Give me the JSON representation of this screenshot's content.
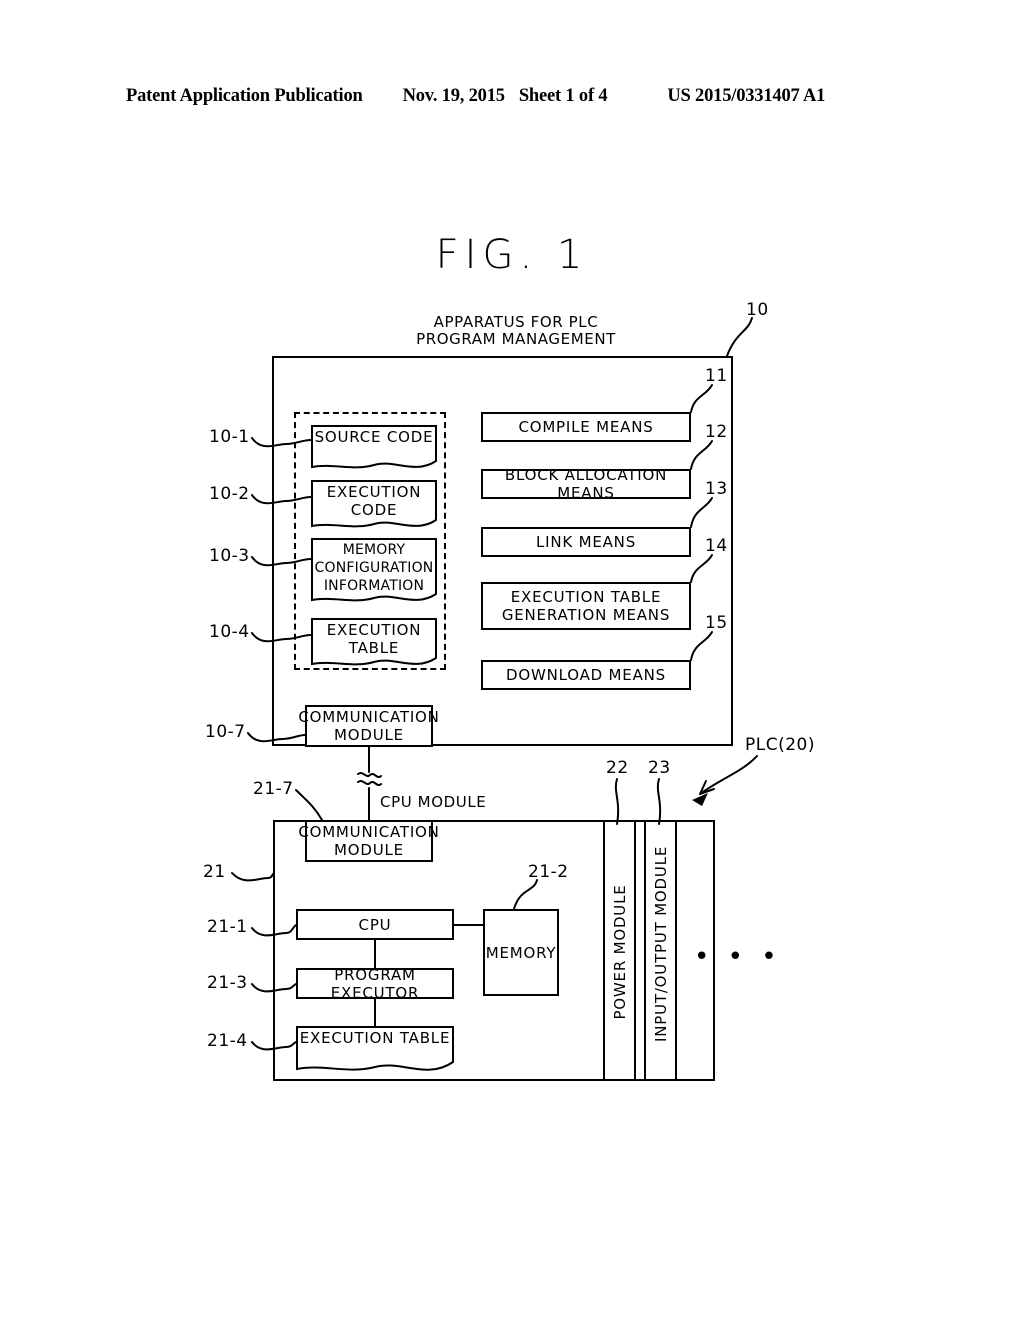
{
  "header": {
    "left": "Patent Application Publication",
    "date": "Nov. 19, 2015",
    "sheet": "Sheet 1 of 4",
    "pub_number": "US 2015/0331407 A1"
  },
  "figure": {
    "title": "FIG. 1",
    "apparatus_caption": "APPARATUS FOR PLC\nPROGRAM MANAGEMENT",
    "apparatus_ref": "10",
    "plc_label": "PLC(20)",
    "cpu_module_label": "CPU MODULE",
    "ellipsis": "• • •"
  },
  "apparatus": {
    "documents": [
      {
        "ref": "10-1",
        "label": "SOURCE CODE"
      },
      {
        "ref": "10-2",
        "label": "EXECUTION\nCODE"
      },
      {
        "ref": "10-3",
        "label": "MEMORY\nCONFIGURATION\nINFORMATION"
      },
      {
        "ref": "10-4",
        "label": "EXECUTION\nTABLE"
      }
    ],
    "means": [
      {
        "ref": "11",
        "label": "COMPILE MEANS"
      },
      {
        "ref": "12",
        "label": "BLOCK ALLOCATION MEANS"
      },
      {
        "ref": "13",
        "label": "LINK MEANS"
      },
      {
        "ref": "14",
        "label": "EXECUTION TABLE\nGENERATION MEANS"
      },
      {
        "ref": "15",
        "label": "DOWNLOAD MEANS"
      }
    ],
    "communication_module": {
      "ref": "10-7",
      "label": "COMMUNICATION\nMODULE"
    }
  },
  "plc": {
    "cpu_module_ref": "21",
    "communication_module": {
      "ref": "21-7",
      "label": "COMMUNICATION\nMODULE"
    },
    "cpu": {
      "ref": "21-1",
      "label": "CPU"
    },
    "memory": {
      "ref": "21-2",
      "label": "MEMORY"
    },
    "program_executor": {
      "ref": "21-3",
      "label": "PROGRAM EXECUTOR"
    },
    "execution_table": {
      "ref": "21-4",
      "label": "EXECUTION TABLE"
    },
    "power_module": {
      "ref": "22",
      "label": "POWER MODULE"
    },
    "io_module": {
      "ref": "23",
      "label": "INPUT/OUTPUT MODULE"
    }
  },
  "colors": {
    "ink": "#000000",
    "paper": "#ffffff"
  }
}
